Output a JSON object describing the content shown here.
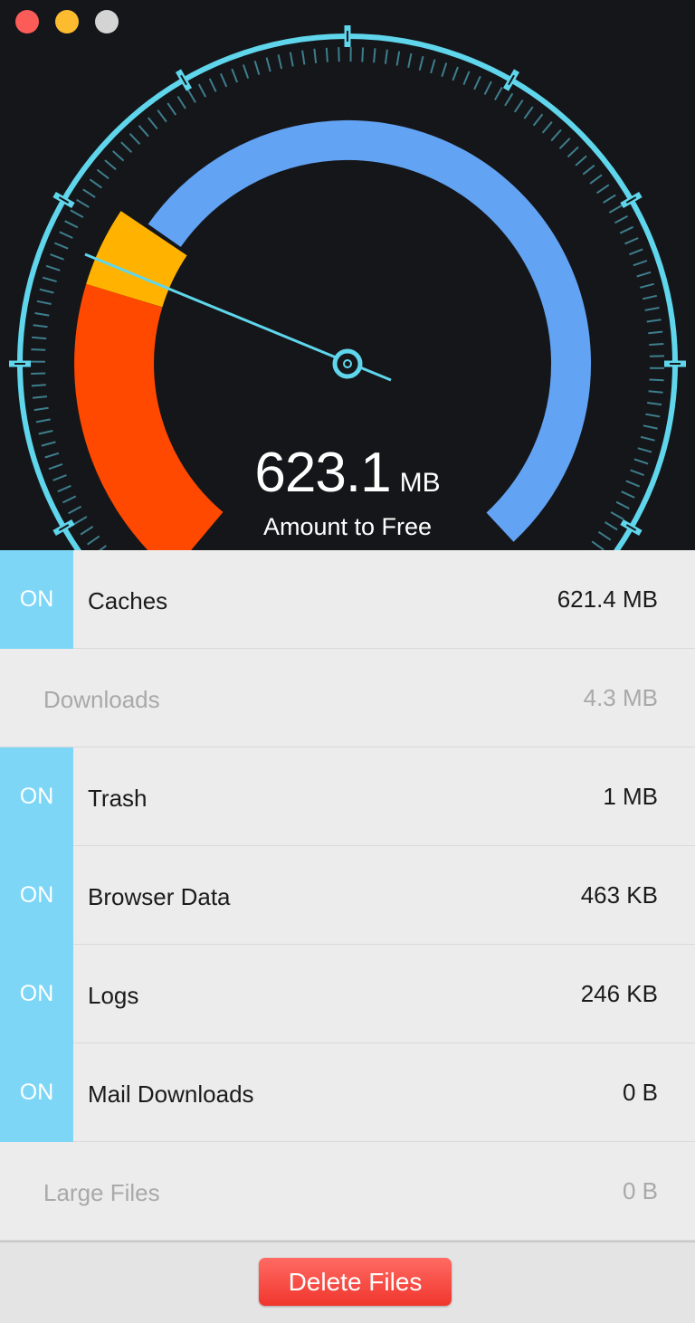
{
  "gauge": {
    "amount_value": "623.1",
    "amount_unit": "MB",
    "caption": "Amount to Free",
    "colors": {
      "ring": "#5fd6ec",
      "used": "#62a3f4",
      "warning": "#ffb300",
      "critical": "#ff4800",
      "background": "#151619"
    }
  },
  "items": [
    {
      "toggle": "ON",
      "label": "Caches",
      "size": "621.4 MB",
      "enabled": true
    },
    {
      "toggle": "",
      "label": "Downloads",
      "size": "4.3 MB",
      "enabled": false
    },
    {
      "toggle": "ON",
      "label": "Trash",
      "size": "1 MB",
      "enabled": true
    },
    {
      "toggle": "ON",
      "label": "Browser Data",
      "size": "463 KB",
      "enabled": true
    },
    {
      "toggle": "ON",
      "label": "Logs",
      "size": "246 KB",
      "enabled": true
    },
    {
      "toggle": "ON",
      "label": "Mail Downloads",
      "size": "0 B",
      "enabled": true
    },
    {
      "toggle": "",
      "label": "Large Files",
      "size": "0 B",
      "enabled": false
    }
  ],
  "footer": {
    "delete_label": "Delete Files"
  }
}
